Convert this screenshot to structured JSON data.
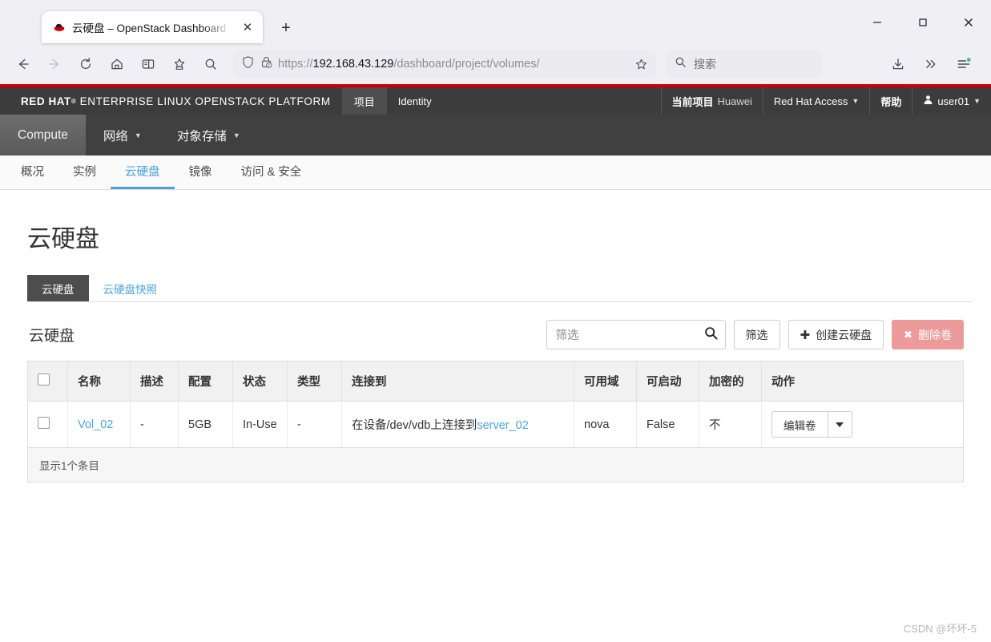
{
  "browser": {
    "tab": {
      "title": "云硬盘 – OpenStack Dashboard",
      "favicon": "redhat-favicon",
      "close_label": "✕"
    },
    "new_tab_label": "+",
    "window_controls": {
      "minimize": "—",
      "maximize": "☐",
      "close": "✕"
    },
    "nav": {
      "back": "back-arrow",
      "forward": "forward-arrow",
      "reload": "reload-arrow",
      "home": "home-house",
      "sidebar": "sidebar-panel",
      "bookmark": "star-plus",
      "find": "magnifier"
    },
    "url": {
      "scheme": "https://",
      "host": "192.168.43.129",
      "path": "/dashboard/project/volumes/",
      "shield": "shield-icon",
      "lock": "lock-warning-icon",
      "bookmark_star": "star-icon"
    },
    "search": {
      "placeholder": "搜索",
      "icon": "search-icon"
    },
    "toolbar_right": {
      "downloads": "download-icon",
      "overflow": "double-chevron-icon",
      "appmenu": "hamburger-icon"
    }
  },
  "header": {
    "accent_color": "#cc0000",
    "brand_red": "RED HAT",
    "brand_sup": "®",
    "brand_rest": "ENTERPRISE LINUX OPENSTACK PLATFORM",
    "tabs": [
      {
        "label": "项目",
        "active": true
      },
      {
        "label": "Identity",
        "active": false
      }
    ],
    "right": {
      "current_project_label": "当前项目",
      "current_project_value": "Huawei",
      "access_label": "Red Hat Access",
      "help_label": "帮助",
      "user_label": "user01"
    }
  },
  "nav_strip": {
    "items": [
      {
        "label": "Compute",
        "active": true,
        "caret": false
      },
      {
        "label": "网络",
        "active": false,
        "caret": true
      },
      {
        "label": "对象存储",
        "active": false,
        "caret": true
      }
    ]
  },
  "sub_tabs": [
    {
      "label": "概况",
      "active": false
    },
    {
      "label": "实例",
      "active": false
    },
    {
      "label": "云硬盘",
      "active": true
    },
    {
      "label": "镜像",
      "active": false
    },
    {
      "label": "访问 & 安全",
      "active": false
    }
  ],
  "page": {
    "title": "云硬盘",
    "content_tabs": [
      {
        "label": "云硬盘",
        "active": true
      },
      {
        "label": "云硬盘快照",
        "active": false
      }
    ],
    "panel_title": "云硬盘",
    "filter_placeholder": "筛选",
    "filter_value": "",
    "filter_button": "筛选",
    "create_button": "创建云硬盘",
    "create_icon": "plus-icon",
    "delete_button": "删除卷",
    "delete_icon": "cross-icon",
    "delete_color": "#ec9a9a",
    "table": {
      "columns": [
        "名称",
        "描述",
        "配置",
        "状态",
        "类型",
        "连接到",
        "可用域",
        "可启动",
        "加密的",
        "动作"
      ],
      "rows": [
        {
          "name": "Vol_02",
          "description": "-",
          "size": "5GB",
          "status": "In-Use",
          "type": "-",
          "attached_prefix": "在设备/dev/vdb上连接到",
          "attached_link": "server_02",
          "availability_zone": "nova",
          "bootable": "False",
          "encrypted": "不",
          "action_label": "编辑卷"
        }
      ],
      "footer": "显示1个条目"
    }
  },
  "watermark": "CSDN @坏坏-5"
}
